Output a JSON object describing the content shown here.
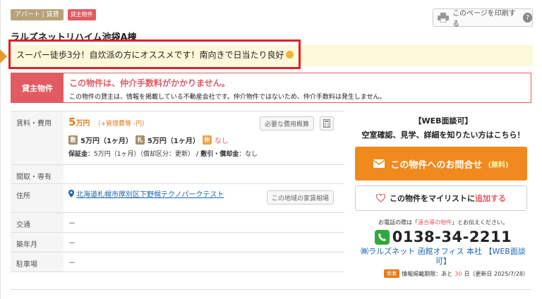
{
  "tags": {
    "type": "アパート | 賃貸",
    "owner": "貸主物件"
  },
  "print": {
    "label": "このページを印刷する",
    "help": "?"
  },
  "property": {
    "title": "ラルズネットリハイム池袋A棟",
    "catch_copy": "スーパー徒歩3分！自炊派の方にオススメです！南向きで日当たり良好"
  },
  "owner_notice": {
    "label": "貸主物件",
    "headline": "この物件は、仲介手数料がかかりません。",
    "detail": "この物件の貸主は、情報を掲載している不動産会社です。仲介物件ではないため、仲介手数料は発生しません。"
  },
  "table": {
    "rent_label": "賃料・費用",
    "rent_value": "5",
    "rent_unit": "万円",
    "mgmt": "（+管理費等 -円）",
    "fee_button": "必要な費用概算",
    "deposit_label": "敷",
    "deposit": "5万円（1ヶ月）",
    "key_money_label": "礼",
    "key_money": "5万円（1ヶ月）",
    "agency_label": "仲",
    "agency": "なし",
    "guarantee_label": "保証金",
    "guarantee": "：5万円（1ヶ月）（償却区分：更新）",
    "amort_label": "/ 敷引・償却金",
    "amort": "：なし",
    "layout_label": "間取・専有",
    "address_label": "住所",
    "address": "北海道札幌市厚別区下野幌テクノパークテスト",
    "market_button": "この地域の家賃相場",
    "traffic_label": "交通",
    "traffic": "－",
    "built_label": "築年月",
    "built": "－",
    "parking_label": "駐車場",
    "parking": "－"
  },
  "right": {
    "web_head": "【WEB面談可】",
    "web_sub": "空室確認、見学、詳細を知りたい方はこちら！",
    "contact_label": "この物件へのお問合せ",
    "contact_free": "(無料)",
    "mylist_prefix": "この物件をマイリストに",
    "mylist_add": "追加する",
    "tel_note_pre": "お電話の際は「",
    "tel_note_q": "遠合導の物件",
    "tel_note_post": "」とお伝えください。",
    "tel": "0138-34-2211",
    "company": "㈱ラルズネット 函館オフィス 本社 【WEB面談可】",
    "new": "新着",
    "period_pre": "情報掲載期限：あと",
    "period_days": "30",
    "period_post": "日（更新日 2025/7/28）"
  },
  "colors": {
    "accent": "#f08a1e",
    "owner": "#e25b62",
    "link": "#1a66b3",
    "highlight": "#e31e24"
  }
}
